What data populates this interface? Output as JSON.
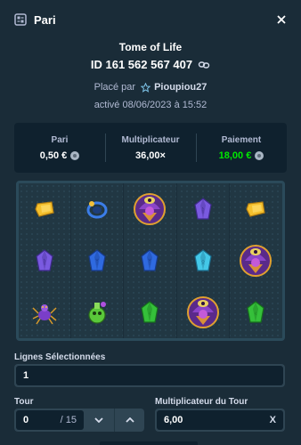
{
  "modal": {
    "title": "Pari",
    "icon": "bet-slip-icon",
    "close_icon": "close-icon"
  },
  "bet": {
    "game_name": "Tome of Life",
    "id": "ID 161 562 567 407",
    "placed_by_prefix": "Placé par",
    "user": "Pioupiou27",
    "activated": "activé 08/06/2023 à 15:52"
  },
  "summary": {
    "bet_label": "Pari",
    "bet_value": "0,50 €",
    "multiplier_label": "Multiplicateur",
    "multiplier_value": "36,00×",
    "payout_label": "Paiement",
    "payout_value": "18,00 €",
    "payout_color": "#00e701"
  },
  "reels": {
    "grid": [
      [
        "gold-gem",
        "blue-ring",
        "anubis-wild",
        "purple-gem",
        "gold-gem"
      ],
      [
        "purple-gem",
        "blue-gem",
        "blue-gem",
        "cyan-gem",
        "anubis-wild"
      ],
      [
        "purple-spider",
        "green-flask",
        "green-gem",
        "anubis-wild",
        "green-gem"
      ]
    ]
  },
  "form": {
    "lines_label": "Lignes Sélectionnées",
    "lines_value": "1",
    "round_label": "Tour",
    "round_value": "0",
    "round_total": "/ 15",
    "round_multiplier_label": "Multiplicateur du Tour",
    "round_multiplier_value": "6,00",
    "clear_symbol": "X"
  },
  "colors": {
    "background": "#1a2c38",
    "panel": "#0f212e",
    "input_border": "#2f4553",
    "accent_green": "#00e701"
  }
}
